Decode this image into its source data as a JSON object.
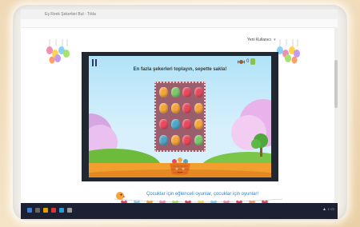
{
  "browser": {
    "tab_title": "Eş Renk Şekerleri Bul - Tıkla",
    "user_name": "Yeni Kullanıcı"
  },
  "game": {
    "instruction": "En fazla şekerleri toplayın, sepette sakla!",
    "score": "0",
    "candies": [
      [
        "#f4a53a",
        "#7bc86a",
        "#e9495e",
        "#e9495e"
      ],
      [
        "#f4a53a",
        "#f4a53a",
        "#e9495e",
        "#f4a53a"
      ],
      [
        "#e9495e",
        "#4ca6c7",
        "#e9495e",
        "#f4a53a"
      ],
      [
        "#4ca6c7",
        "#f4a53a",
        "#e9495e",
        "#7bc86a"
      ]
    ]
  },
  "banner": {
    "text": "Çocuklar için eğlenceli oyunlar, çocuklar için oyunlar!"
  },
  "colors": {
    "board": "#9a5e6d",
    "frame": "#222831",
    "taskbar": "#1b2033"
  },
  "icons": [
    "pause-icon",
    "candy-icon",
    "basket-icon",
    "lollipop-decoration-icon",
    "heart-garland-icon"
  ]
}
